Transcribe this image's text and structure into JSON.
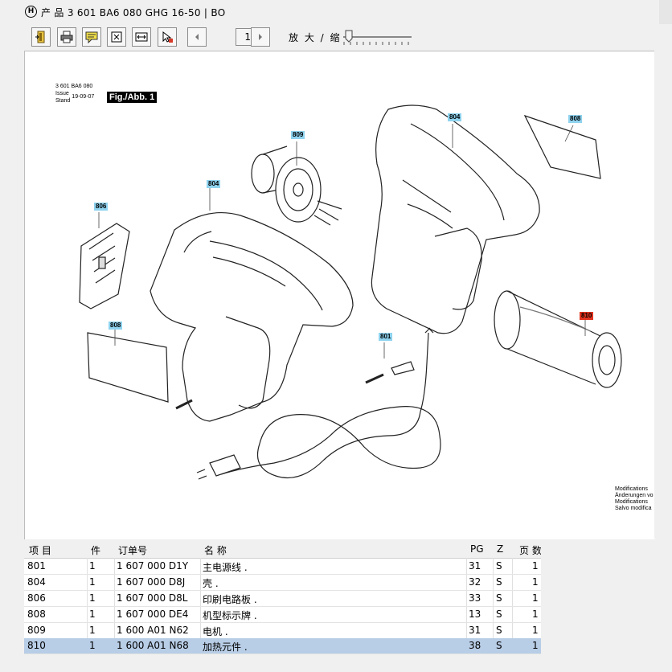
{
  "window": {
    "title": "产 品 3 601 BA6 080     GHG 16-50 | BO",
    "logo_text": "H"
  },
  "toolbar": {
    "buttons": [
      "exit-icon",
      "print-icon",
      "comment-icon",
      "fit-page-icon",
      "fit-width-icon",
      "cursor-icon"
    ],
    "page_indicator": "1/1",
    "zoom_label": "放 大 / 缩",
    "zoom_level": 0.05
  },
  "drawing": {
    "doc_number": "3 601 BA6 080",
    "issue_label": "Issue",
    "stand_label": "Stand",
    "issue_date": "19-09-07",
    "figure_label": "Fig./Abb. 1",
    "modifications": [
      "Modifications",
      "Änderungen vo",
      "Modifications",
      "Salvo modifica"
    ],
    "callouts": {
      "c804a": "804",
      "c808a": "808",
      "c809": "809",
      "c804b": "804",
      "c806": "806",
      "c808b": "808",
      "c801": "801",
      "c810": "810"
    },
    "colors": {
      "callout": "#8fd3ef",
      "selected_callout": "#e0331f"
    }
  },
  "table": {
    "columns": [
      "项 目",
      "件",
      "订单号",
      "名 称",
      "PG",
      "Z",
      "页 数"
    ],
    "rows": [
      {
        "item": "801",
        "qty": "1",
        "order": "1 607 000 D1Y",
        "name": "主电源线  .",
        "pg": "31",
        "z": "S",
        "pages": "1"
      },
      {
        "item": "804",
        "qty": "1",
        "order": "1 607 000 D8J",
        "name": "壳  .",
        "pg": "32",
        "z": "S",
        "pages": "1"
      },
      {
        "item": "806",
        "qty": "1",
        "order": "1 607 000 D8L",
        "name": "印刷电路板  .",
        "pg": "33",
        "z": "S",
        "pages": "1"
      },
      {
        "item": "808",
        "qty": "1",
        "order": "1 607 000 DE4",
        "name": "机型标示牌  .",
        "pg": "13",
        "z": "S",
        "pages": "1"
      },
      {
        "item": "809",
        "qty": "1",
        "order": "1 600 A01 N62",
        "name": "电机  .",
        "pg": "31",
        "z": "S",
        "pages": "1"
      },
      {
        "item": "810",
        "qty": "1",
        "order": "1 600 A01 N68",
        "name": "加热元件  .",
        "pg": "38",
        "z": "S",
        "pages": "1"
      }
    ],
    "selected_item": "810",
    "selected_color": "#b8cde6"
  }
}
